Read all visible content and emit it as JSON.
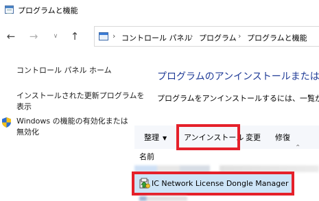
{
  "window": {
    "title": "プログラムと機能"
  },
  "nav": {
    "back_icon": "arrow-left-icon",
    "forward_icon": "arrow-right-icon",
    "recent_icon": "chevron-down-icon",
    "up_icon": "arrow-up-icon"
  },
  "address": {
    "crumbs": [
      "コントロール パネル",
      "プログラム",
      "プログラムと機能"
    ]
  },
  "sidebar": {
    "home": "コントロール パネル ホーム",
    "updates_line1": "インストールされた更新プログラムを",
    "updates_line2": "表示",
    "features_line1": "Windows の機能の有効化または",
    "features_line2": "無効化"
  },
  "main": {
    "title": "プログラムのアンインストールまたは変更",
    "description": "プログラムをアンインストールするには、一覧からプログラ"
  },
  "toolbar": {
    "organize": "整理",
    "uninstall": "アンインストール",
    "change": "変更",
    "repair": "修復"
  },
  "list": {
    "column_name": "名前",
    "items": [
      {
        "name": "IC Network License Dongle Manager",
        "selected": true
      }
    ]
  },
  "colors": {
    "accent_title": "#1e3a96",
    "highlight_box": "#e5202a",
    "selection": "#cde4f7"
  }
}
